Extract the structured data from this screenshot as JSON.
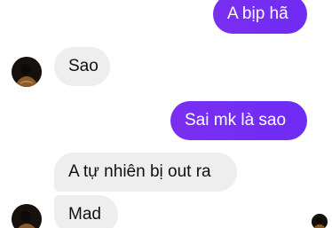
{
  "messages": [
    {
      "direction": "outgoing",
      "text": "A bịp hã"
    },
    {
      "direction": "incoming",
      "text": "Sao"
    },
    {
      "direction": "outgoing",
      "text": "Sai mk là sao"
    },
    {
      "direction": "incoming",
      "text": "A tự nhiên bị out ra"
    },
    {
      "direction": "incoming",
      "text": "Mad"
    }
  ],
  "colors": {
    "outgoing_bubble": "#7a2ff0",
    "incoming_bubble": "#eeeeef",
    "background": "#ffffff"
  }
}
